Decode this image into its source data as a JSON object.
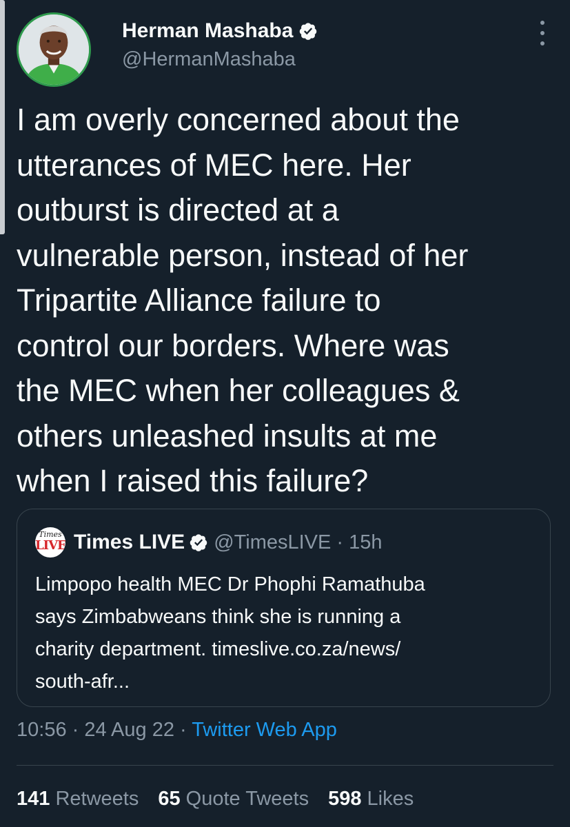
{
  "author": {
    "display_name": "Herman Mashaba",
    "handle": "@HermanMashaba"
  },
  "tweet": {
    "text": "I am overly concerned about the\nutterances of MEC here. Her\noutburst is directed at a\nvulnerable person, instead of her\nTripartite Alliance failure to\ncontrol our borders. Where was\nthe MEC when her colleagues &\nothers unleashed insults at me\nwhen I raised this failure?"
  },
  "quoted": {
    "logo_top": "Times",
    "logo_bottom": "LIVE",
    "display_name": "Times LIVE",
    "meta": "@TimesLIVE · 15h",
    "text": "Limpopo health MEC Dr Phophi Ramathuba\nsays Zimbabweans think she is running a\ncharity department. timeslive.co.za/news/\nsouth-afr..."
  },
  "timestamp": {
    "time_date": "10:56 · 24 Aug 22 · ",
    "source": "Twitter Web App"
  },
  "stats": {
    "retweets_count": "141",
    "retweets_label": "Retweets",
    "quotes_count": "65",
    "quotes_label": "Quote Tweets",
    "likes_count": "598",
    "likes_label": "Likes"
  },
  "colors": {
    "background": "#15202b",
    "accent": "#1d9bf0",
    "secondary_text": "#8b98a5"
  },
  "icons": [
    "avatar",
    "verified-badge-icon",
    "more-options-icon",
    "timeslive-logo"
  ]
}
